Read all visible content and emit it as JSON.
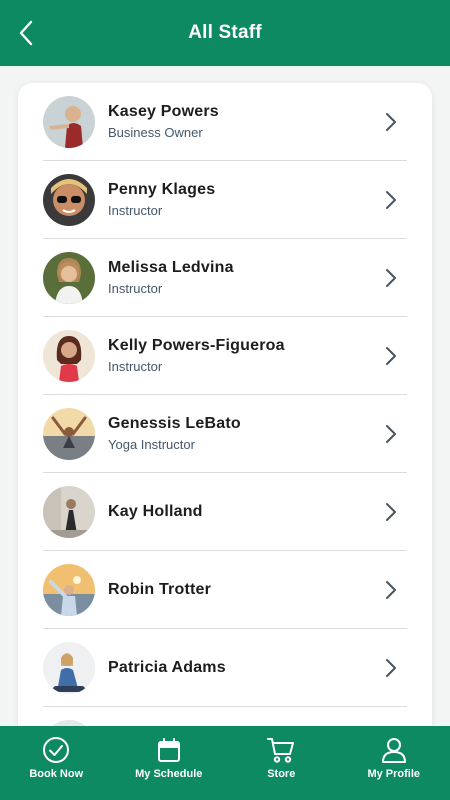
{
  "header": {
    "title": "All Staff",
    "back_icon": "chevron-left-icon"
  },
  "staff": [
    {
      "name": "Kasey Powers",
      "role": "Business Owner"
    },
    {
      "name": "Penny Klages",
      "role": "Instructor"
    },
    {
      "name": "Melissa Ledvina",
      "role": "Instructor"
    },
    {
      "name": "Kelly Powers-Figueroa",
      "role": "Instructor"
    },
    {
      "name": "Genessis LeBato",
      "role": "Yoga Instructor"
    },
    {
      "name": "Kay Holland",
      "role": ""
    },
    {
      "name": "Robin Trotter",
      "role": ""
    },
    {
      "name": "Patricia Adams",
      "role": ""
    }
  ],
  "tabs": [
    {
      "label": "Book Now",
      "icon": "check-circle-icon"
    },
    {
      "label": "My Schedule",
      "icon": "calendar-icon"
    },
    {
      "label": "Store",
      "icon": "cart-icon"
    },
    {
      "label": "My Profile",
      "icon": "person-icon"
    }
  ],
  "colors": {
    "brand": "#0e8a63",
    "role_text": "#44576b"
  }
}
